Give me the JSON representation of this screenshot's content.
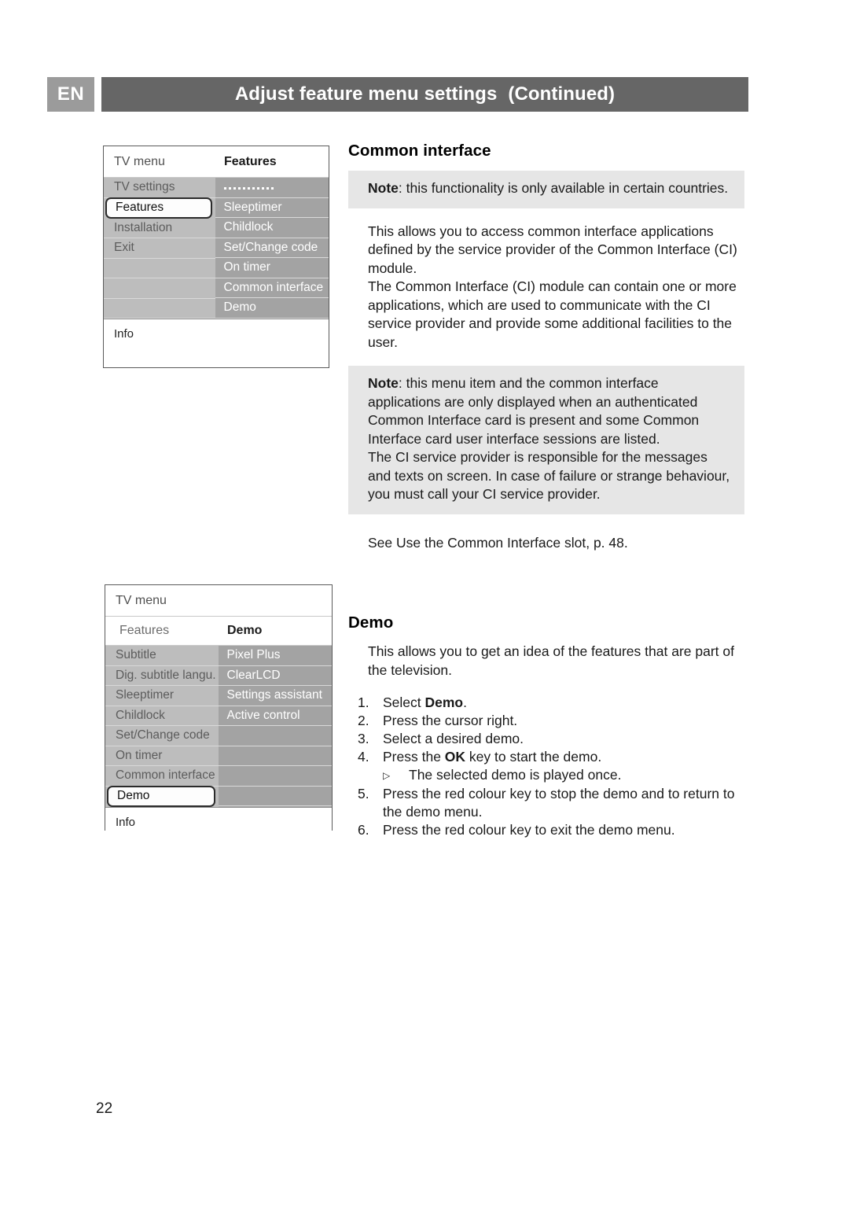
{
  "header": {
    "language": "EN",
    "title_main": "Adjust feature menu settings",
    "title_continued": "(Continued)"
  },
  "tv_menu_features": {
    "topbar_left": "TV menu",
    "topbar_right": "Features",
    "left_items": [
      "TV settings",
      "Features",
      "Installation",
      "Exit",
      "",
      "",
      ""
    ],
    "left_selected": "Features",
    "right_items": [
      "",
      "Sleeptimer",
      "Childlock",
      "Set/Change code",
      "On timer",
      "Common interface",
      "Demo"
    ],
    "info_label": "Info"
  },
  "tv_menu_demo": {
    "topbar_left": "TV menu",
    "secondbar_left": "Features",
    "secondbar_right": "Demo",
    "left_items": [
      "Subtitle",
      "Dig. subtitle langu.",
      "Sleeptimer",
      "Childlock",
      "Set/Change code",
      "On timer",
      "Common interface",
      "Demo"
    ],
    "left_selected": "Demo",
    "right_items": [
      "Pixel Plus",
      "ClearLCD",
      "Settings assistant",
      "Active control",
      "",
      "",
      "",
      ""
    ],
    "info_label": "Info"
  },
  "common_interface": {
    "title": "Common interface",
    "note1_label": "Note",
    "note1_text": ": this functionality is only available in certain countries.",
    "body1": "This allows you to access common interface applications defined by the service provider of the Common Interface (CI) module.",
    "body2": "The Common Interface (CI) module can contain one or more applications, which are used to communicate with the CI service provider and provide some additional facilities to the user.",
    "note2_label": "Note",
    "note2_text": ": this menu item and the common interface applications are only displayed when an authenticated Common Interface card is present and some Common Interface card user interface sessions are listed.",
    "note2_text2": "The CI service provider is responsible for the messages and texts on screen. In case of failure or strange behaviour, you must call your CI service provider.",
    "see_also": "See Use the Common Interface slot, p. 48."
  },
  "demo_section": {
    "title": "Demo",
    "intro": "This allows you to get an idea of the features that are part of the television.",
    "steps": [
      {
        "num": "1.",
        "pre": "Select ",
        "bold": "Demo",
        "post": "."
      },
      {
        "num": "2.",
        "pre": "Press the cursor right.",
        "bold": "",
        "post": ""
      },
      {
        "num": "3.",
        "pre": "Select a desired demo.",
        "bold": "",
        "post": ""
      },
      {
        "num": "4.",
        "pre": "Press the ",
        "bold": "OK",
        "post": " key to start the demo."
      }
    ],
    "substep_marker": "▷",
    "substep_text": "The selected demo is played once.",
    "steps2": [
      {
        "num": "5.",
        "pre": "Press the red colour key to stop the demo and to return to the demo menu.",
        "bold": "",
        "post": ""
      },
      {
        "num": "6.",
        "pre": "Press the red colour key to exit the demo menu.",
        "bold": "",
        "post": ""
      }
    ]
  },
  "page_number": "22"
}
